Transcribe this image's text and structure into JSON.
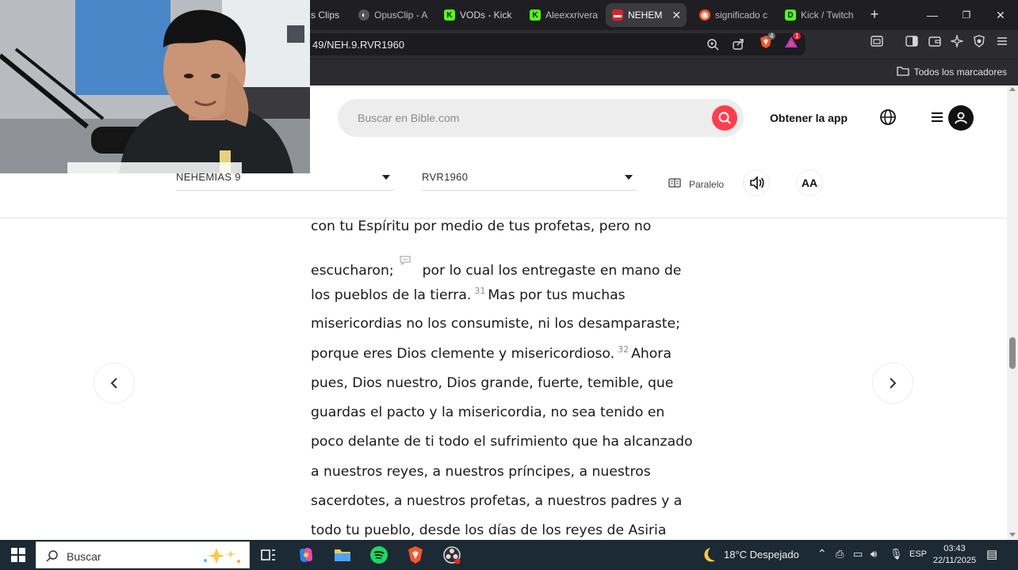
{
  "browser": {
    "tabs": [
      {
        "label": "s Clips",
        "favicon": "clips-favicon"
      },
      {
        "label": "OpusClip - A",
        "favicon": "opusclip-favicon"
      },
      {
        "label": "VODs - Kick",
        "favicon": "kick-favicon"
      },
      {
        "label": "Aleexxrivera",
        "favicon": "kick-favicon"
      },
      {
        "label": "NEHEM",
        "favicon": "bible-favicon",
        "active": true
      },
      {
        "label": "significado c",
        "favicon": "brave-search-favicon"
      },
      {
        "label": "Kick / Twitch",
        "favicon": "kick-twitch-favicon"
      }
    ],
    "new_tab": "+",
    "url": "49/NEH.9.RVR1960",
    "brave_shield_badge": "4",
    "rewards_badge": "1",
    "bookmarks_folder": "Todos los marcadores",
    "accent_color": "#ff3d4d"
  },
  "header": {
    "search_placeholder": "Buscar en Bible.com",
    "get_app": "Obtener la app"
  },
  "reader": {
    "book_chapter": "NEHEMÍAS 9",
    "version": "RVR1960",
    "parallel": "Paralelo",
    "font_button": "AA"
  },
  "passage": {
    "l1": "con tu Espíritu por medio de tus profetas, pero no",
    "l2a": "escucharon;",
    "l2b": "por lo cual los entregaste en mano de",
    "l3a": "los pueblos de la tierra.",
    "v31": "31",
    "l3b": "Mas por tus muchas",
    "l4": "misericordias no los consumiste, ni los desamparaste;",
    "l5a": "porque eres Dios clemente y misericordioso.",
    "v32": "32",
    "l5b": "Ahora",
    "l6": "pues, Dios nuestro, Dios grande, fuerte, temible, que",
    "l7": "guardas el pacto y la misericordia, no sea tenido en",
    "l8": "poco delante de ti todo el sufrimiento que ha alcanzado",
    "l9": "a nuestros reyes, a nuestros príncipes, a nuestros",
    "l10": "sacerdotes, a nuestros profetas, a nuestros padres y a",
    "l11": "todo tu pueblo, desde los días de los reyes de Asiria"
  },
  "taskbar": {
    "search": "Buscar",
    "weather": "18°C  Despejado",
    "language": "ESP",
    "time": "03:43",
    "date": "22/11/2025"
  }
}
